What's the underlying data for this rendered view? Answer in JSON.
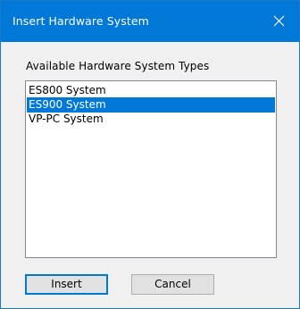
{
  "window": {
    "title": "Insert Hardware System",
    "close_icon": "close-icon"
  },
  "group": {
    "label": "Available Hardware System Types"
  },
  "list": {
    "items": [
      {
        "label": "ES800 System",
        "selected": false
      },
      {
        "label": "ES900 System",
        "selected": true
      },
      {
        "label": "VP-PC System",
        "selected": false
      }
    ]
  },
  "buttons": {
    "insert_label": "Insert",
    "cancel_label": "Cancel"
  },
  "colors": {
    "accent": "#0078d7",
    "dialog_bg": "#f0f0f0",
    "button_bg": "#e1e1e1"
  }
}
